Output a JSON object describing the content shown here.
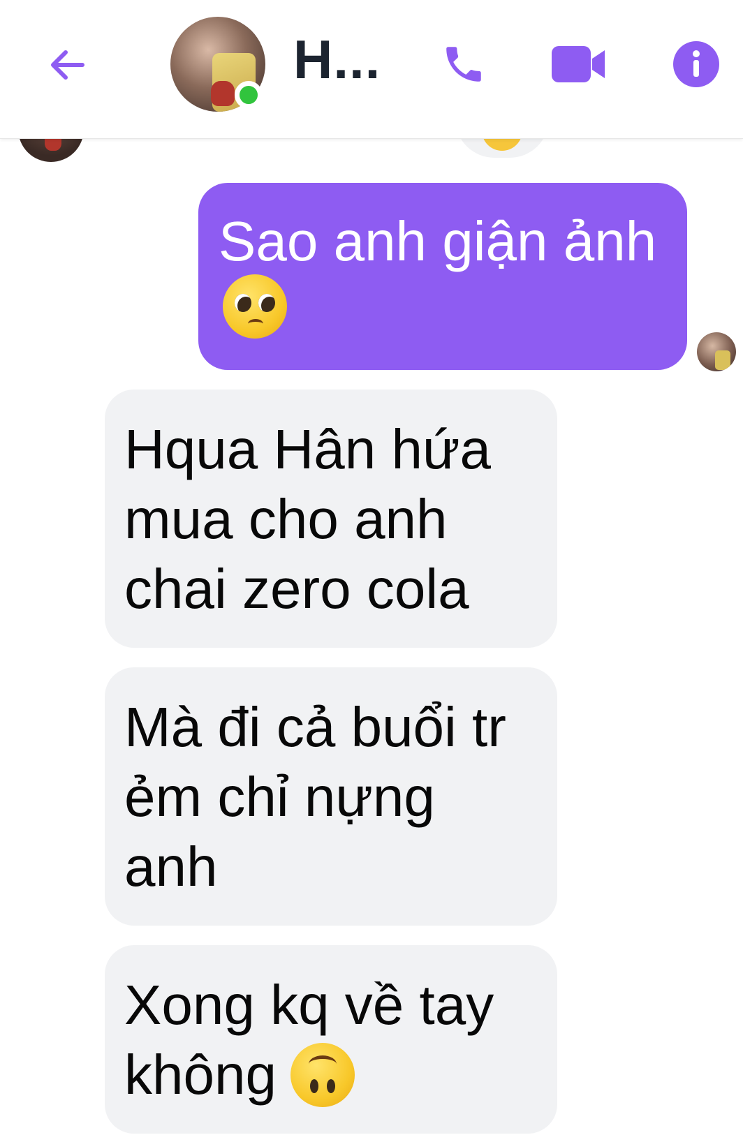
{
  "header": {
    "contact_name": "H...",
    "back_icon": "arrow-left-icon",
    "call_icon": "phone-icon",
    "video_icon": "video-camera-icon",
    "info_icon": "info-icon",
    "online": true,
    "accent_color": "#8e5cf2"
  },
  "messages": [
    {
      "direction": "outgoing",
      "text": "Sao anh giận ảnh",
      "emoji": "pleading-face-emoji"
    },
    {
      "direction": "incoming",
      "text": "Hqua Hân hứa mua cho anh chai zero cola"
    },
    {
      "direction": "incoming",
      "text": "Mà đi cả buổi tr ẻm chỉ nựng anh"
    },
    {
      "direction": "incoming",
      "text": "Xong kq về tay không",
      "emoji": "upside-down-face-emoji"
    }
  ],
  "colors": {
    "outgoing_bubble": "#8e5cf2",
    "incoming_bubble": "#f1f2f4",
    "online_dot": "#31c43d"
  }
}
